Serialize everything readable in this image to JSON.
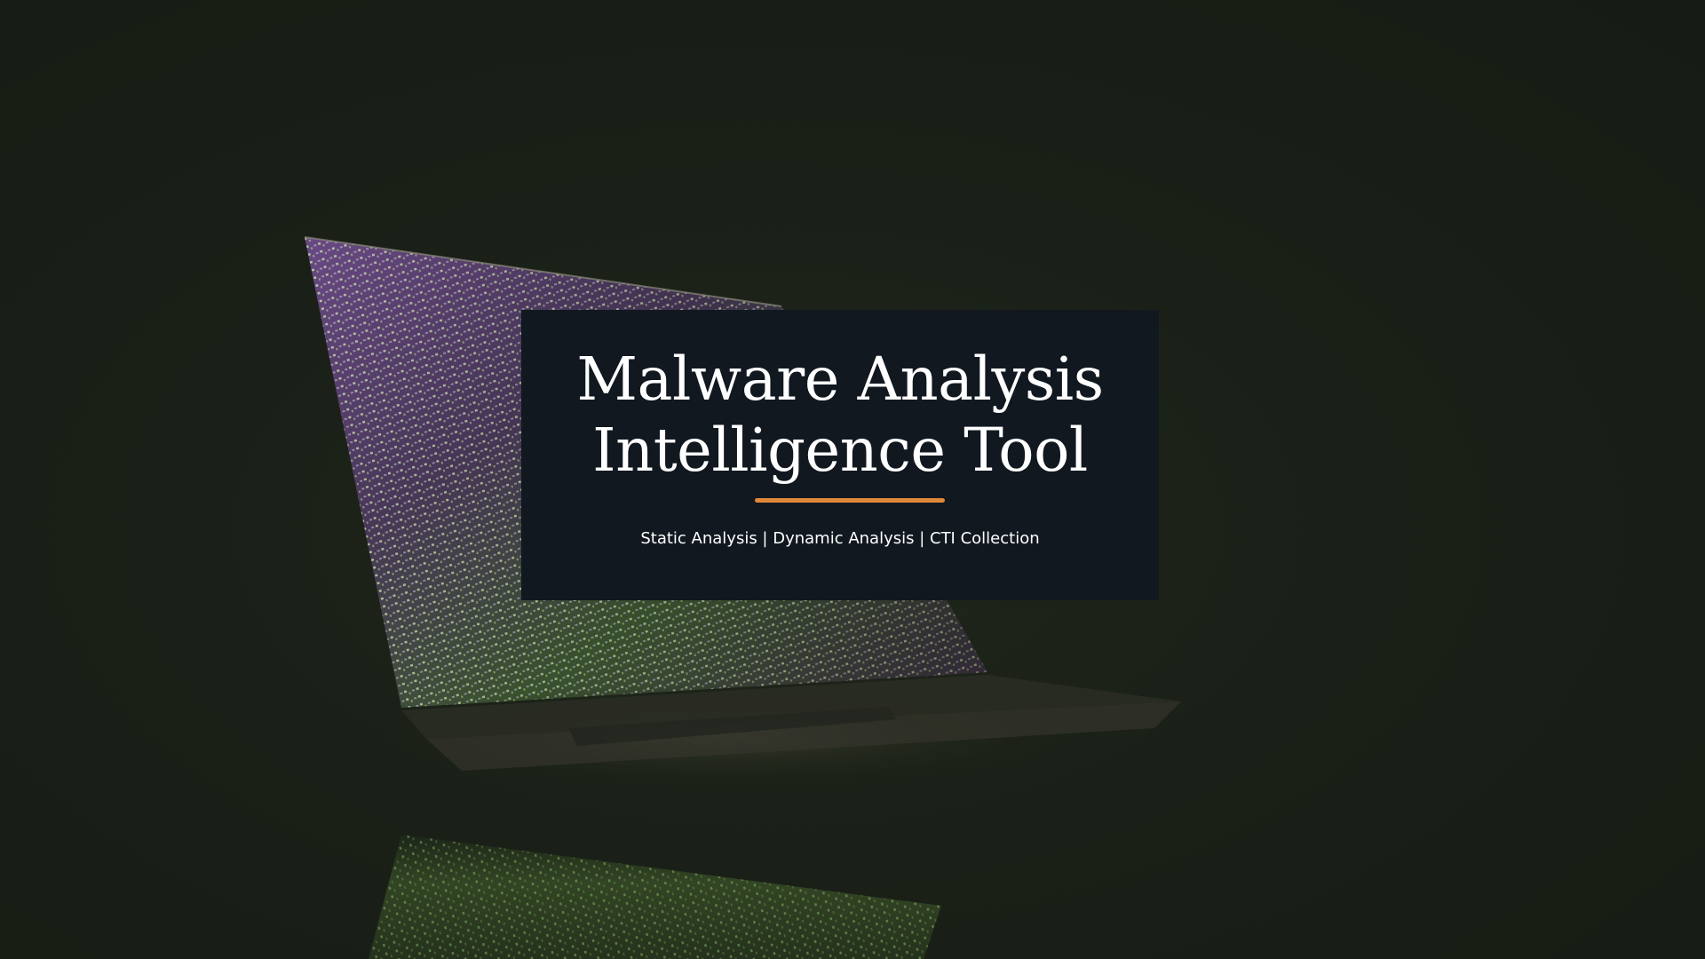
{
  "slide": {
    "title_line_1": "Malware Analysis",
    "title_line_2": "Intelligence Tool",
    "subtitle": "Static Analysis | Dynamic Analysis | CTI Collection"
  },
  "background": {
    "image": "laptop-with-code-rain-photo",
    "base_color": "#1a2016"
  },
  "colors": {
    "card_background": "#111820",
    "accent": "#e0883a",
    "text": "#ffffff"
  }
}
